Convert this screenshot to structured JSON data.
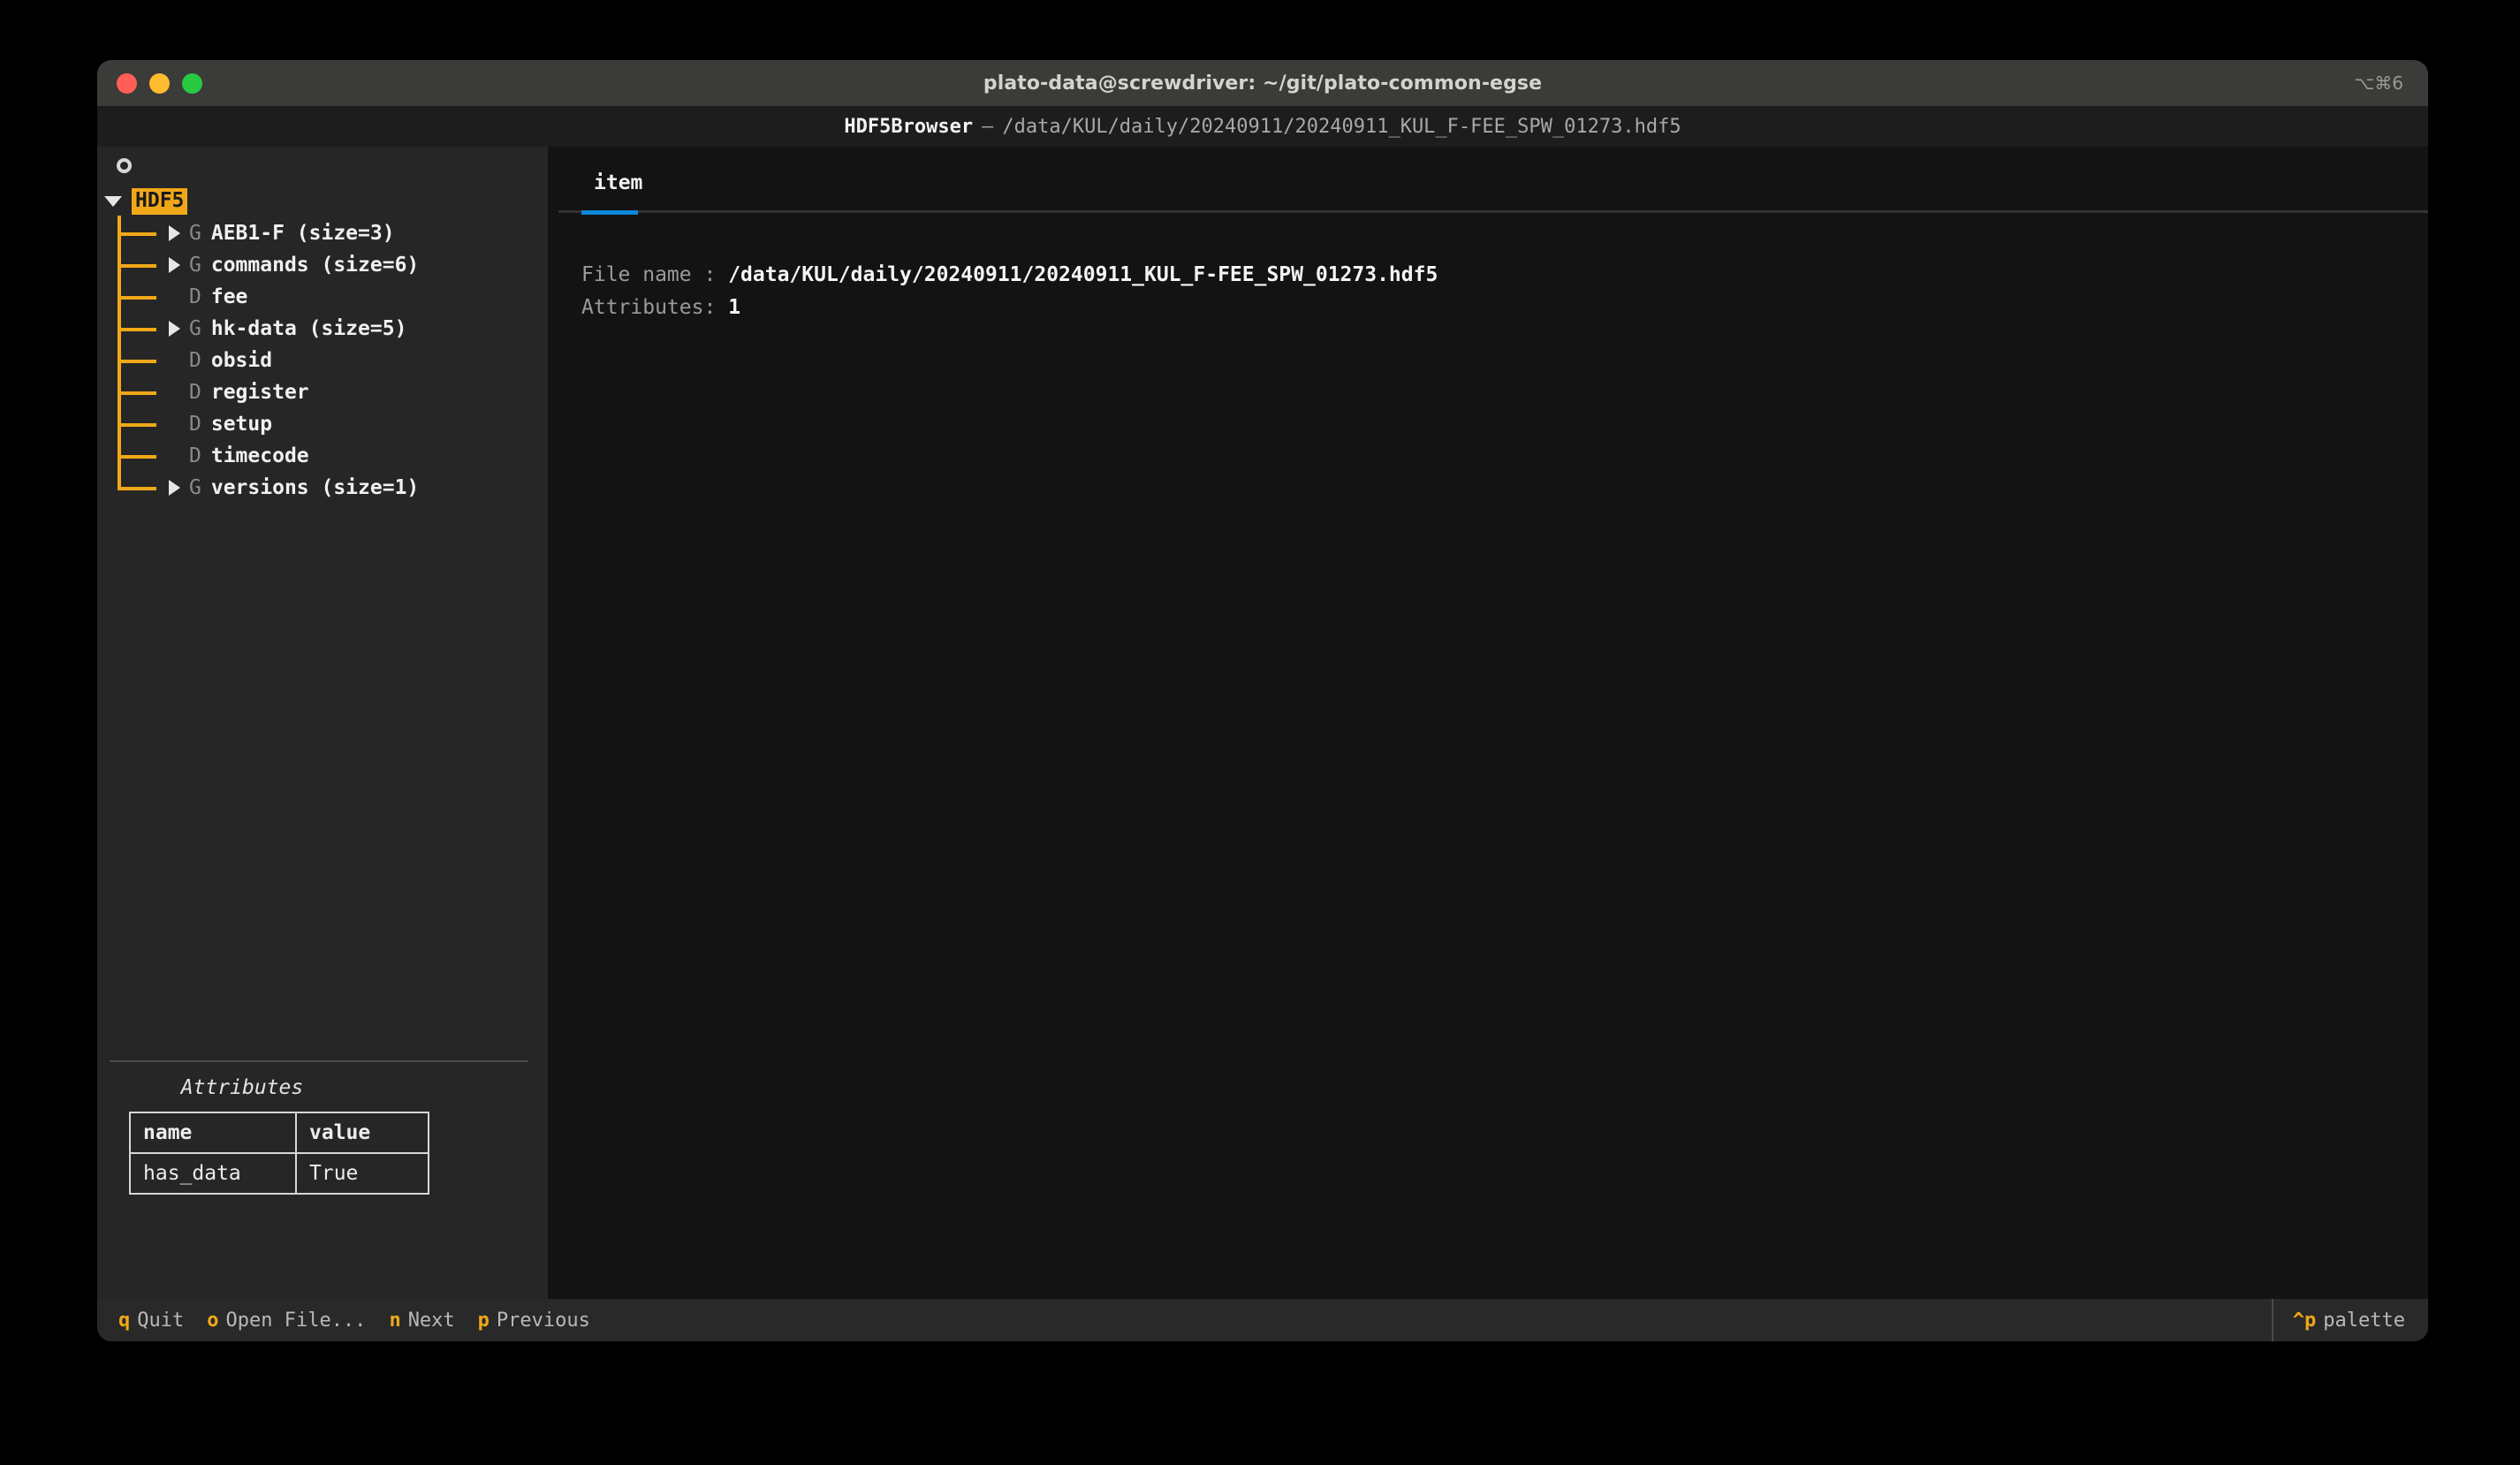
{
  "window": {
    "title": "plato-data@screwdriver: ~/git/plato-common-egse",
    "shortcut": "⌥⌘6"
  },
  "app_header": {
    "name": "HDF5Browser",
    "separator": "—",
    "path": "/data/KUL/daily/20240911/20240911_KUL_F-FEE_SPW_01273.hdf5"
  },
  "tree": {
    "root_label": "HDF5",
    "items": [
      {
        "expandable": true,
        "type": "G",
        "name": "AEB1-F (size=3)"
      },
      {
        "expandable": true,
        "type": "G",
        "name": "commands (size=6)"
      },
      {
        "expandable": false,
        "type": "D",
        "name": "fee"
      },
      {
        "expandable": true,
        "type": "G",
        "name": "hk-data (size=5)"
      },
      {
        "expandable": false,
        "type": "D",
        "name": "obsid"
      },
      {
        "expandable": false,
        "type": "D",
        "name": "register"
      },
      {
        "expandable": false,
        "type": "D",
        "name": "setup"
      },
      {
        "expandable": false,
        "type": "D",
        "name": "timecode"
      },
      {
        "expandable": true,
        "type": "G",
        "name": "versions (size=1)"
      }
    ]
  },
  "attributes_panel": {
    "title": "Attributes",
    "columns": [
      "name",
      "value"
    ],
    "rows": [
      {
        "name": "has_data",
        "value": "True"
      }
    ]
  },
  "content": {
    "tabs": [
      {
        "label": "item",
        "active": true
      }
    ],
    "fields": [
      {
        "key": "File name :",
        "value": "/data/KUL/daily/20240911/20240911_KUL_F-FEE_SPW_01273.hdf5"
      },
      {
        "key": "Attributes:",
        "value": "1"
      }
    ]
  },
  "footer": {
    "bindings": [
      {
        "key": "q",
        "label": "Quit"
      },
      {
        "key": "o",
        "label": "Open File..."
      },
      {
        "key": "n",
        "label": "Next"
      },
      {
        "key": "p",
        "label": "Previous"
      }
    ],
    "palette": {
      "key": "^p",
      "label": "palette"
    }
  },
  "colors": {
    "accent_orange": "#f0a818",
    "accent_blue": "#0d87d8",
    "tree_pane_bg": "#262626",
    "content_pane_bg": "#131313",
    "titlebar_bg": "#3b3b39"
  }
}
